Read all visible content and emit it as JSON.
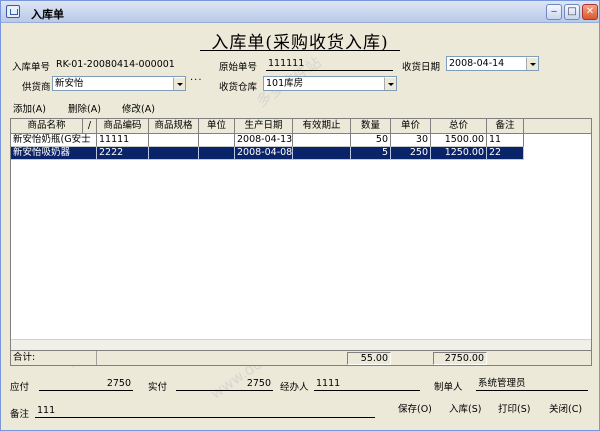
{
  "window": {
    "title": "入库单"
  },
  "heading": "入库单(采购收货入库)",
  "form": {
    "order_no_label": "入库单号",
    "order_no_value": "RK-01-20080414-000001",
    "orig_no_label": "原始单号",
    "orig_no_value": "111111",
    "recv_date_label": "收货日期",
    "recv_date_value": "2008-04-14",
    "supplier_label": "供货商",
    "supplier_value": "新安怡",
    "ellipsis": "···",
    "warehouse_label": "收货仓库",
    "warehouse_value": "101库房"
  },
  "toolbar": {
    "add": "添加(A)",
    "delete": "删除(A)",
    "edit": "修改(A)"
  },
  "table": {
    "columns": [
      "商品名称",
      "/",
      "商品编码",
      "商品规格",
      "单位",
      "生产日期",
      "有效期止",
      "数量",
      "单价",
      "总价",
      "备注"
    ],
    "rows": [
      {
        "name": "新安怡奶瓶(G安士",
        "code": "11111",
        "spec": "",
        "unit": "",
        "prod_date": "2008-04-13",
        "expiry": "",
        "qty": "50",
        "price": "30",
        "total": "1500.00",
        "note": "11"
      },
      {
        "name": "新安怡吸奶器",
        "code": "2222",
        "spec": "",
        "unit": "",
        "prod_date": "2008-04-08",
        "expiry": "",
        "qty": "5",
        "price": "250",
        "total": "1250.00",
        "note": "22"
      }
    ],
    "sum_label": "合计:",
    "sum_qty": "55.00",
    "sum_total": "2750.00"
  },
  "footer": {
    "payable_label": "应付",
    "payable_value": "2750",
    "paid_label": "实付",
    "paid_value": "2750",
    "handler_label": "经办人",
    "handler_value": "1111",
    "creator_label": "制单人",
    "creator_value": "系统管理员",
    "remark_label": "备注",
    "remark_value": "111"
  },
  "buttons": {
    "save": "保存(O)",
    "stock_in": "入库(S)",
    "print": "打印(S)",
    "close": "关闭(C)"
  }
}
